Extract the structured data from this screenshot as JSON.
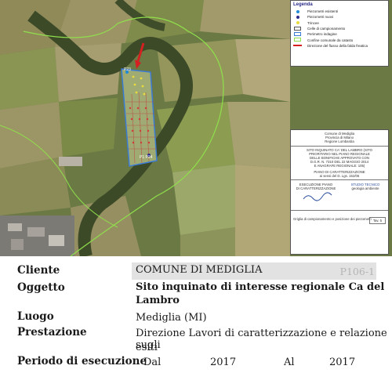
{
  "map": {
    "legend": {
      "title": "Legenda",
      "items": [
        {
          "label": "Piezometri esistenti",
          "color": "#1f8ad8",
          "symbol": "dot"
        },
        {
          "label": "Piezometri nuovi",
          "color": "#2b2b8c",
          "symbol": "dot"
        },
        {
          "label": "Trincee",
          "color": "#e8dc3a",
          "symbol": "dot"
        },
        {
          "label": "Celle di campionamento",
          "color": "#555555",
          "symbol": "box"
        },
        {
          "label": "Perimetro indagine",
          "color": "#3a7bd5",
          "symbol": "box"
        },
        {
          "label": "Confine comunale da catasto",
          "color": "#8fe04c",
          "symbol": "box"
        },
        {
          "label": "Direzione del flusso della falda freatica",
          "color": "#d42020",
          "symbol": "arrow"
        }
      ]
    },
    "titleblock": {
      "municipality": [
        "Comune di Mediglia",
        "Provincia di Milano",
        "Regione Lombardia"
      ],
      "site": [
        "SITO INQUINATO CA' DEL LAMBRO (SITO",
        "PRIORITARIO NEL PIANO REGIONALE",
        "DELLE BONIFICHE APPROVATO CON",
        "D.G.R. N. 7310 DEL 22 MAGGIO 2014",
        "E ANAGRAFE REGIONALE: 105)"
      ],
      "plan": [
        "PIANO DI CARATTERIZZAZIONE",
        "ai sensi del D. Lgs. 152/06"
      ],
      "left_block": [
        "ESECUZIONE PIANO",
        "DI CARATTERIZZAZIONE"
      ],
      "right_block": [
        "STUDIO TECNICO",
        "geologia ambiente"
      ],
      "footer_text": "Griglia di campionamento e posizione dei piezometri",
      "table_label": "Tav. 5"
    },
    "labels": {
      "p1": "P23",
      "p2": "P1 P24"
    }
  },
  "info": {
    "cliente_label": "Cliente",
    "cliente_value": "COMUNE DI MEDIGLIA",
    "code": "P106-1",
    "oggetto_label": "Oggetto",
    "oggetto_value_line1": "Sito inquinato di interesse regionale Ca del",
    "oggetto_value_line2": "Lambro",
    "luogo_label": "Luogo",
    "luogo_value": "Mediglia (MI)",
    "prestazione_label": "Prestazione",
    "prestazione_value_line1": "Direzione Lavori di caratterizzazione e relazione sugli",
    "prestazione_value_line2": "esiti",
    "periodo_label": "Periodo di esecuzione",
    "periodo_dal": "Dal",
    "periodo_start": "2017",
    "periodo_al": "Al",
    "periodo_end": "2017"
  }
}
